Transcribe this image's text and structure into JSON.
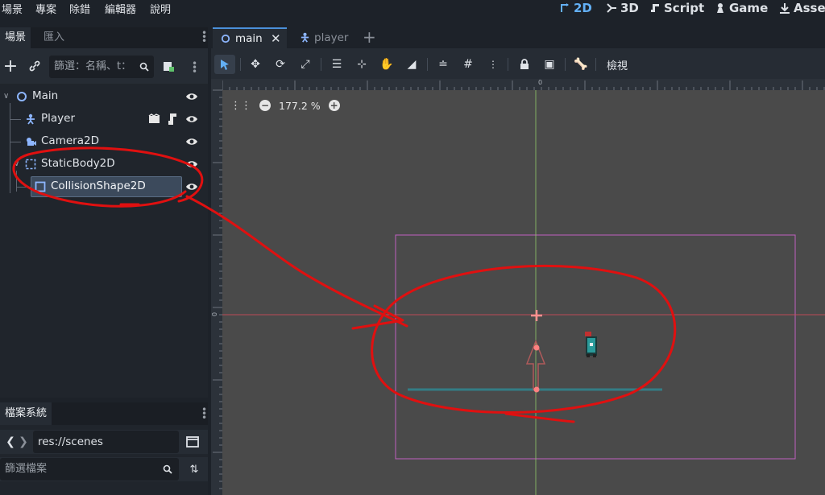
{
  "menu": [
    "場景",
    "專案",
    "除錯",
    "編輯器",
    "說明"
  ],
  "modes": [
    {
      "label": "2D",
      "active": true
    },
    {
      "label": "3D",
      "active": false
    },
    {
      "label": "Script",
      "active": false
    },
    {
      "label": "Game",
      "active": false
    },
    {
      "label": "Asset",
      "active": false
    }
  ],
  "scene_dock": {
    "tabs": [
      "場景",
      "匯入"
    ],
    "filter_placeholder": "篩選：名稱、t：",
    "tree": [
      {
        "label": "Main",
        "icon": "node2d-icon",
        "depth": 0
      },
      {
        "label": "Player",
        "icon": "player-icon",
        "depth": 1
      },
      {
        "label": "Camera2D",
        "icon": "camera-icon",
        "depth": 1
      },
      {
        "label": "StaticBody2D",
        "icon": "staticbody-icon",
        "depth": 1
      },
      {
        "label": "CollisionShape2D",
        "icon": "collisionshape-icon",
        "depth": 2,
        "selected": true
      }
    ]
  },
  "filesystem_dock": {
    "tab": "檔案系統",
    "path": "res://scenes",
    "filter_placeholder": "篩選檔案"
  },
  "editor": {
    "tabs": [
      {
        "label": "main",
        "active": true
      },
      {
        "label": "player",
        "active": false
      }
    ],
    "view_menu": "檢視",
    "zoom": "177.2 %",
    "ruler_zero": "0"
  },
  "colors": {
    "accent": "#63b0f5",
    "annotation": "#e01010",
    "viewport_bg": "#4a4a4a",
    "camera_rect": "#c060c0"
  }
}
